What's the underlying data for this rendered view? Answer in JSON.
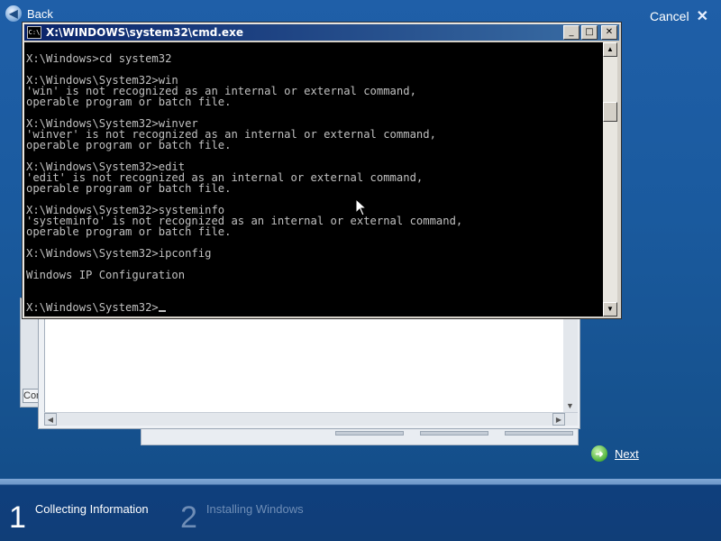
{
  "setup": {
    "back_label": "Back",
    "cancel_label": "Cancel",
    "next_label": "Next",
    "partial_label": "Con",
    "steps": [
      {
        "number": "1",
        "label": "Collecting Information"
      },
      {
        "number": "2",
        "label": "Installing Windows"
      }
    ]
  },
  "cmd": {
    "title": "X:\\WINDOWS\\system32\\cmd.exe",
    "icon_text": "C:\\",
    "controls": {
      "minimize": "_",
      "maximize": "□",
      "close": "✕"
    },
    "lines": [
      "",
      "X:\\Windows>cd system32",
      "",
      "X:\\Windows\\System32>win",
      "'win' is not recognized as an internal or external command,",
      "operable program or batch file.",
      "",
      "X:\\Windows\\System32>winver",
      "'winver' is not recognized as an internal or external command,",
      "operable program or batch file.",
      "",
      "X:\\Windows\\System32>edit",
      "'edit' is not recognized as an internal or external command,",
      "operable program or batch file.",
      "",
      "X:\\Windows\\System32>systeminfo",
      "'systeminfo' is not recognized as an internal or external command,",
      "operable program or batch file.",
      "",
      "X:\\Windows\\System32>ipconfig",
      "",
      "Windows IP Configuration",
      "",
      ""
    ],
    "prompt": "X:\\Windows\\System32>"
  },
  "icons": {
    "back": "back-arrow-icon",
    "cancel": "close-icon",
    "next": "next-arrow-icon",
    "cmd": "cmd-icon",
    "pointer": "mouse-pointer-icon"
  },
  "colors": {
    "desktop_bg": "#1a5a9e",
    "console_bg": "#000000",
    "console_text": "#c0c0c0",
    "titlebar": "#0a246a",
    "next_green": "#4fb33a"
  }
}
